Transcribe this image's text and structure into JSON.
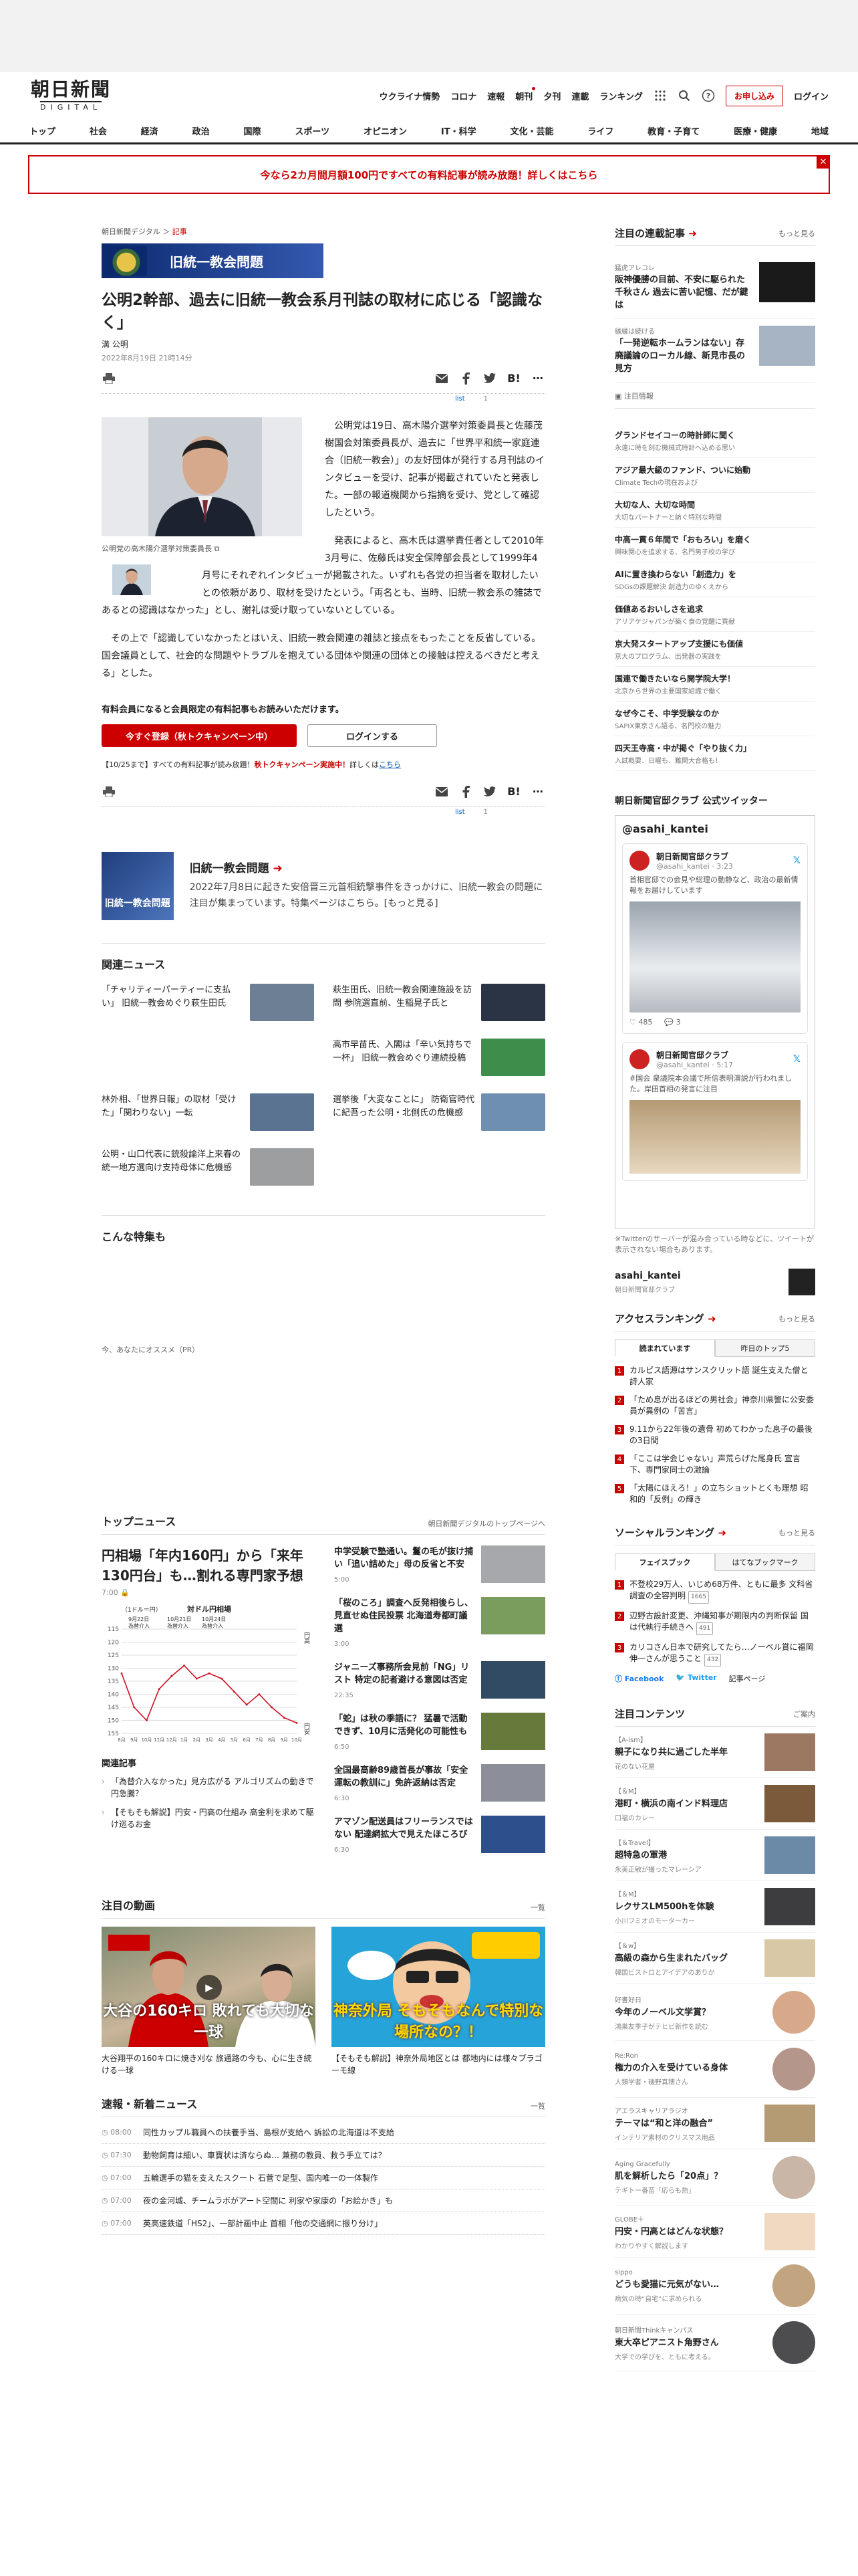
{
  "header": {
    "logo_main": "朝日新聞",
    "logo_sub": "DIGITAL",
    "nav": [
      "ウクライナ情勢",
      "コロナ",
      "速報",
      "朝刊",
      "夕刊",
      "連載",
      "ランキング"
    ],
    "subscribe": "お申し込み",
    "login": "ログイン",
    "help": "?",
    "categories": [
      "トップ",
      "社会",
      "経済",
      "政治",
      "国際",
      "スポーツ",
      "オピニオン",
      "IT・科学",
      "文化・芸能",
      "ライフ",
      "教育・子育て",
      "医療・健康",
      "地域"
    ]
  },
  "promo": {
    "text": "今なら2カ月間月額100円ですべての有料記事が読み放題！詳しくはこちら",
    "close": "✕"
  },
  "breadcrumb": {
    "site": "朝日新聞デジタル",
    "sep": "＞",
    "section": "記事"
  },
  "series": {
    "label": "旧統一教会問題"
  },
  "article": {
    "title": "公明2幹部、過去に旧統一教会系月刊誌の取材に応じる「認識なく」",
    "author": "溝 公明",
    "date": "2022年8月19日 21時14分",
    "list_label": "list",
    "bookmark_count": "1",
    "photo_caption": "公明党の高木陽介選挙対策委員長",
    "paragraphs": [
      "公明党は19日、高木陽介選挙対策委員長と佐藤茂樹国会対策委員長が、過去に「世界平和統一家庭連合（旧統一教会）」の友好団体が発行する月刊誌のインタビューを受け、記事が掲載されていたと発表した。一部の報道機関から指摘を受け、党として確認したという。",
      "発表によると、高木氏は選挙責任者として2010年3月号に、佐藤氏は安全保障部会長として1999年4月号にそれぞれインタビューが掲載された。いずれも各党の担当者を取材したいとの依頼があり、取材を受けたという。「両名とも、当時、旧統一教会系の雑誌であるとの認識はなかった」とし、謝礼は受け取っていないとしている。",
      "その上で「認識していなかったとはいえ、旧統一教会関連の雑誌と接点をもったことを反省している。国会議員として、社会的な問題やトラブルを抱えている団体や関連の団体との接触は控えるべきだと考える」とした。"
    ]
  },
  "membership": {
    "notice": "有料会員になると会員限定の有料記事もお読みいただけます。",
    "register": "今すぐ登録（秋トクキャンペーン中）",
    "login": "ログインする",
    "campaign_prefix": "【10/25まで】すべての有料記事が読み放題！",
    "campaign_red": "秋トクキャンペーン実施中！",
    "campaign_link_text": "詳しくは",
    "campaign_link": "こちら"
  },
  "special": {
    "image_label": "旧統一教会問題",
    "title": "旧統一教会問題",
    "desc": "2022年7月8日に起きた安倍晋三元首相銃撃事件をきっかけに、旧統一教会の問題に注目が集まっています。特集ページはこちら。[もっと見る]"
  },
  "related": {
    "title": "関連ニュース",
    "items": [
      {
        "t": "「チャリティーパーティーに支払い」 旧統一教会めぐり萩生田氏",
        "c": "#6d7f94"
      },
      {
        "t": "萩生田氏、旧統一教会関連施設を訪問 参院選直前、生稲晃子氏と",
        "c": "#2b3444"
      },
      {
        "t": "",
        "c": ""
      },
      {
        "t": "高市早苗氏、入閣は「辛い気持ちで一杯」 旧統一教会めぐり連続投稿",
        "c": "#3f8d4a"
      },
      {
        "t": "林外相、「世界日報」の取材「受けた」「関わりない」一転",
        "c": "#5a7391"
      },
      {
        "t": "選挙後「大変なことに」 防衛官時代に紀吾った公明・北側氏の危機感",
        "c": "#6f8fb0"
      },
      {
        "t": "公明・山口代表に銃殺論洋上来春の統一地方選向け支持母体に危機感",
        "c": "#9d9ea0"
      }
    ]
  },
  "samples": {
    "title": "こんな特集も"
  },
  "recommend": {
    "label": "今、あなたにオススメ（PR）"
  },
  "topnews": {
    "title": "トップニュース",
    "more": "朝日新聞デジタルのトップページへ",
    "lead_title": "円相場「年内160円」から「来年130円台」も…割れる専門家予想",
    "lead_time": "7:00",
    "related_label": "関連記事",
    "related": [
      "「為替介入なかった」見方広がる アルゴリズムの動きで円急騰？",
      "【そもそも解説】円安・円高の仕組み 高金利を求めて駆け巡るお金"
    ],
    "items": [
      {
        "t": "中学受験で塾通い。鬘の毛が抜け捕い「追い詰めた」母の反省と不安",
        "tm": "5:00",
        "c": "#a6a8ab"
      },
      {
        "t": "「桜のころ」調査へ反発相後らし、見直せぬ住民投票 北海道寿都町議選",
        "tm": "3:00",
        "c": "#7a9c5c"
      },
      {
        "t": "ジャニーズ事務所会見前「NG」リスト 特定の記者避ける意図は否定",
        "tm": "22:35",
        "c": "#304b63"
      },
      {
        "t": "「蛇」は秋の季語に？ 猛暑で活動できず、10月に活発化の可能性も",
        "tm": "6:50",
        "c": "#667a3c"
      },
      {
        "t": "全国最高齢89歳首長が事故「安全運転の教訓に」免許返納は否定",
        "tm": "6:30",
        "c": "#8c8f99"
      },
      {
        "t": "アマゾン配送員はフリーランスではない 配達網拡大で見えたほころび",
        "tm": "6:30",
        "c": "#2d4f8c"
      }
    ]
  },
  "chart_data": {
    "type": "line",
    "title": "対ドル円相場",
    "ylabel": "（1ドル＝円）",
    "yticks": [
      115,
      120,
      125,
      130,
      135,
      140,
      145,
      150,
      155
    ],
    "ylim": [
      115,
      155
    ],
    "ylim_labels": {
      "top": "円高",
      "bottom": "円安"
    },
    "x": [
      "8月",
      "9月",
      "10月",
      "11月",
      "12月",
      "1月",
      "2月",
      "3月",
      "4月",
      "5月",
      "6月",
      "7月",
      "8月",
      "9月",
      "10月"
    ],
    "values": [
      132,
      145,
      150,
      138,
      133,
      129,
      134,
      132,
      134,
      139,
      144,
      140,
      145,
      149,
      151
    ],
    "annotations": [
      {
        "label": "9月22日 為替介入"
      },
      {
        "label": "10月21日 為替介入"
      },
      {
        "label": "10月24日 為替介入"
      }
    ],
    "line_color": "#cc1122"
  },
  "videos": {
    "title": "注目の動画",
    "more": "一覧",
    "items": [
      {
        "cap": "大谷翔平の160キロに焼き刈な 旅通路の今も、心に生き続ける一球",
        "overlay": "大谷の160キロ 敗れても大切な一球"
      },
      {
        "cap": "【そもそも解説】神奈外局地区とは 都地内には様々ブラゴーモ線",
        "overlay": "神奈外局 そもそもなんで特別な場所なの？！"
      }
    ]
  },
  "breaking": {
    "title": "速報・新着ニュース",
    "more": "一覧",
    "items": [
      {
        "tm": "08:00",
        "t": "同性カップル職員への扶養手当、島根が支給へ 訴訟の北海道は不支給"
      },
      {
        "tm": "07:30",
        "t": "動物飼育は細い、車寶状は済ならぬ… 兼務の教員、救う手立ては？"
      },
      {
        "tm": "07:00",
        "t": "五輪選手の猫を支えたスクート 石菅で足型、国内唯一の一体製作"
      },
      {
        "tm": "07:00",
        "t": "夜の金河城、チームラボがアート空間に 利家や家康の「お絵かき」も"
      },
      {
        "tm": "07:00",
        "t": "英高速鉄道「HS2」、一部計画中止 首相「他の交通網に振り分け」"
      }
    ]
  },
  "sidebar": {
    "rensai": {
      "title": "注目の連載記事",
      "more": "もっと見る",
      "items": [
        {
          "src": "猛虎アレコレ",
          "t": "阪神優勝の目前、不安に駆られた千秋さん 過去に苦い記憶、だが鍵は",
          "c": "#1a1a1a"
        },
        {
          "src": "縁縁は続ける",
          "t": "「一発逆転ホームランはない」存廃議論のローカル線、新見市長の見方",
          "c": "#a7b4c4"
        }
      ]
    },
    "notice": "注目情報",
    "pr": [
      {
        "t": "グランドセイコーの時計師に聞く",
        "s": "永遠に時を刻む機械式時計へ込める思い"
      },
      {
        "t": "アジア最大級のファンド、ついに始動",
        "s": "Climate Techの現在および"
      },
      {
        "t": "大切な人、大切な時間",
        "s": "大切なパートナーと紡ぐ特別な時間"
      },
      {
        "t": "中高一貫６年間で「おもろい」を磨く",
        "s": "興味関心を追求する、名門男子校の学び"
      },
      {
        "t": "AIに置き換わらない「創造力」を",
        "s": "SDGsの課題解決 創造力のゆくえから"
      },
      {
        "t": "価値あるおいしさを追求",
        "s": "アリアケジャパンが築く食の覚醒に貢献"
      },
      {
        "t": "京大発スタートアップ支援にも価値",
        "s": "京大のプログラム、出発器の実践を"
      },
      {
        "t": "国連で働きたいなら開学院大学！",
        "s": "北京から世界の主要国家組織で働く"
      },
      {
        "t": "なぜ今こそ、中学受験なのか",
        "s": "SAPIX東京さん語る、名門校の魅力"
      },
      {
        "t": "四天王寺高・中が掲ぐ「やり抜く力」",
        "s": "入試概要、日曜も、難関大合格も！"
      }
    ],
    "twitter": {
      "heading": "朝日新聞官邸クラブ 公式ツイッター",
      "account": "@asahi_kantei",
      "handle": "@asahi_kantei",
      "name": "朝日新聞官邸クラブ",
      "time1": "3:23",
      "time2": "5:17",
      "text1": "首相官邸での会見や総理の動静など、政治の最新情報をお届けしています",
      "text2": "#国会 衆議院本会議で所信表明演説が行われました。岸田首相の発言に注目",
      "likes": "485",
      "replies": "3",
      "foot": "※Twitterのサーバーが混み合っている時などに、ツイートが表示されない場合もあります。",
      "acc_name": "asahi_kantei",
      "acc_sub": "朝日新聞官邸クラブ"
    },
    "ranking": {
      "title": "アクセスランキング",
      "more": "もっと見る",
      "tab1": "読まれています",
      "tab2": "昨日のトップ5",
      "items": [
        "カルピス語源はサンスクリット語 誕生支えた僧と詩人家",
        "「ため息が出るほどの男社会」神奈川県警に公安委員が異例の「苦言」",
        "9.11から22年後の遺骨 初めてわかった息子の最後の3日間",
        "「ここは学会じゃない」声荒らげた尾身氏 宣言下、専門家同士の激論",
        "「太陽にほえろ！」の立ちショットとくも理想 昭和的「反例」の輝き"
      ]
    },
    "social": {
      "title": "ソーシャルランキング",
      "more": "もっと見る",
      "tab1": "フェイスブック",
      "tab2": "はてなブックマーク",
      "items": [
        {
          "t": "不登校29万人、いじめ68万件、ともに最多 文科省調査の全容判明",
          "cnt": "1665"
        },
        {
          "t": "辺野古設計変更、沖縄知事が期限内の判断保留 国は代執行手続きへ",
          "cnt": "491"
        },
        {
          "t": "カリコさん日本で研究してたら…ノーベル賞に福岡伸一さんが思うこと",
          "cnt": "432"
        }
      ],
      "fb": "Facebook",
      "tw": "Twitter",
      "rules": "記事ページ"
    },
    "contents": {
      "title": "注目コンテンツ",
      "more": "ご案内",
      "items": [
        {
          "tag": "【A-ism】",
          "t": "親子になり共に過ごした半年",
          "s": "花のない花屋",
          "c": "#9c7862",
          "round": false
        },
        {
          "tag": "【＆M】",
          "t": "港町・横浜の南インド料理店",
          "s": "口福のカレー",
          "c": "#7a5a3a",
          "round": false
        },
        {
          "tag": "【＆Travel】",
          "t": "超特急の軍港",
          "s": "永美正敏が撮ったマレーシア",
          "c": "#6b8aa8",
          "round": false
        },
        {
          "tag": "【＆M】",
          "t": "レクサスLM500hを体験",
          "s": "小川フミオのモーターカー",
          "c": "#3d3d40",
          "round": false
        },
        {
          "tag": "【＆w】",
          "t": "高級の森から生まれたバッグ",
          "s": "韓国ビストロとアイデアのありか",
          "c": "#d9c8a6",
          "round": false
        },
        {
          "tag": "好書好日",
          "t": "今年のノーベル文学賞？",
          "s": "鴻巣友季子がテヒビ新作を読む",
          "c": "#d7a88a",
          "round": true
        },
        {
          "tag": "Re:Ron",
          "t": "権力の介入を受けている身体",
          "s": "人類学者・磯野真穂さん",
          "c": "#b5968a",
          "round": true
        },
        {
          "tag": "アエラスキャリアラジオ",
          "t": "テーマは“和と洋の融合”",
          "s": "インテリア素材のクリスマス用品",
          "c": "#b49b73",
          "round": false
        },
        {
          "tag": "Aging Gracefully",
          "t": "肌を解析したら「20点」？",
          "s": "テギトー番苗「応らも熱」",
          "c": "#c9b6a6",
          "round": true
        },
        {
          "tag": "GLOBE＋",
          "t": "円安・円高とはどんな状態？",
          "s": "わかりやすく解説します",
          "c": "#f1d9c1",
          "round": false
        },
        {
          "tag": "sippo",
          "t": "どうも愛猫に元気がない…",
          "s": "病気の時“自宅”に求められる",
          "c": "#c2a480",
          "round": true
        },
        {
          "tag": "朝日新聞Thinkキャンパス",
          "t": "東大卒ピアニスト角野さん",
          "s": "大学での学びを、ともに考える。",
          "c": "#4d4d50",
          "round": true
        }
      ]
    }
  }
}
